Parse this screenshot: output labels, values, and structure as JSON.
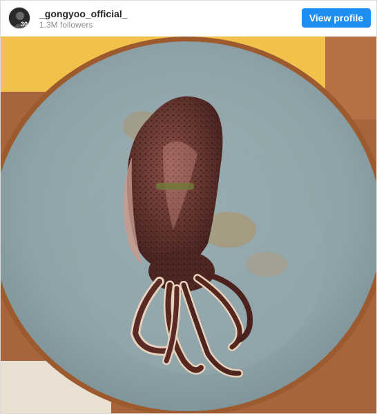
{
  "header": {
    "username": "_gongyoo_official_",
    "followers": "1.3M followers",
    "view_profile_label": "View profile",
    "avatar_badge": "30",
    "button_color": "#1e8ef0"
  },
  "photo": {
    "subject": "grilled-squid-on-plate",
    "colors": {
      "table": "#b06a3c",
      "plate_rim": "#a05a2c",
      "plate": "#8fa3a8",
      "placemat": "#f2c24a",
      "squid": "#5a2e2a"
    }
  }
}
